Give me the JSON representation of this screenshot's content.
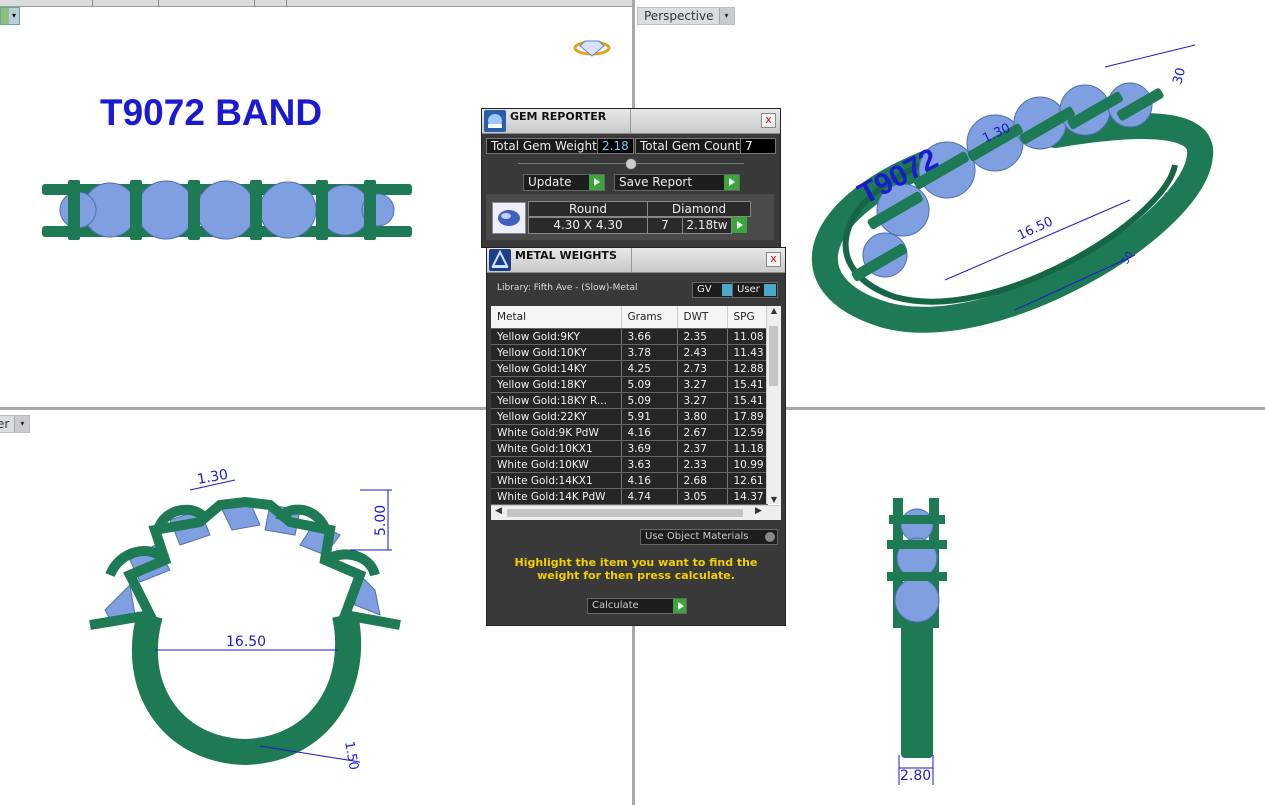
{
  "viewports": {
    "top_left": {
      "title_text": "T9072 BAND"
    },
    "top_right": {
      "tab_label": "Perspective",
      "dims": [
        "30",
        "1.30",
        "16.50",
        "50",
        "T9072"
      ]
    },
    "bottom_left": {
      "tab_label": "er",
      "dims": [
        "1.30",
        "5.00",
        "16.50",
        "1.50"
      ]
    },
    "bottom_right": {
      "dims": [
        "2.80"
      ]
    }
  },
  "gem_reporter": {
    "title": "GEM REPORTER",
    "close_glyph": "x",
    "total_weight_label": "Total Gem Weight",
    "total_weight_value": "2.18",
    "total_count_label": "Total Gem Count",
    "total_count_value": "7",
    "update_label": "Update",
    "save_report_label": "Save Report",
    "table_header_shape": "Round",
    "table_header_material": "Diamond",
    "row_size": "4.30 X 4.30",
    "row_count": "7",
    "row_weight": "2.18tw"
  },
  "metal_weights": {
    "title": "METAL WEIGHTS",
    "close_glyph": "x",
    "library_label": "Library: Fifth Ave - (Slow)-Metal",
    "gv_label": "GV",
    "user_label": "User",
    "columns": [
      "Metal",
      "Grams",
      "DWT",
      "SPG"
    ],
    "rows": [
      [
        "Yellow Gold:9KY",
        "3.66",
        "2.35",
        "11.08"
      ],
      [
        "Yellow Gold:10KY",
        "3.78",
        "2.43",
        "11.43"
      ],
      [
        "Yellow Gold:14KY",
        "4.25",
        "2.73",
        "12.88"
      ],
      [
        "Yellow Gold:18KY",
        "5.09",
        "3.27",
        "15.41"
      ],
      [
        "Yellow Gold:18KY R...",
        "5.09",
        "3.27",
        "15.41"
      ],
      [
        "Yellow Gold:22KY",
        "5.91",
        "3.80",
        "17.89"
      ],
      [
        "White Gold:9K PdW",
        "4.16",
        "2.67",
        "12.59"
      ],
      [
        "White Gold:10KX1",
        "3.69",
        "2.37",
        "11.18"
      ],
      [
        "White Gold:10KW",
        "3.63",
        "2.33",
        "10.99"
      ],
      [
        "White Gold:14KX1",
        "4.16",
        "2.68",
        "12.61"
      ],
      [
        "White Gold:14K PdW",
        "4.74",
        "3.05",
        "14.37"
      ]
    ],
    "use_object_materials_label": "Use Object Materials",
    "hint": "Highlight the item you want to find the weight for then press calculate.",
    "calculate_label": "Calculate"
  },
  "colors": {
    "metal_green": "#1e7a55",
    "gem_blue": "#7f9fe0",
    "dimension_blue": "#1a1ad0",
    "hint_yellow": "#f5d000"
  }
}
